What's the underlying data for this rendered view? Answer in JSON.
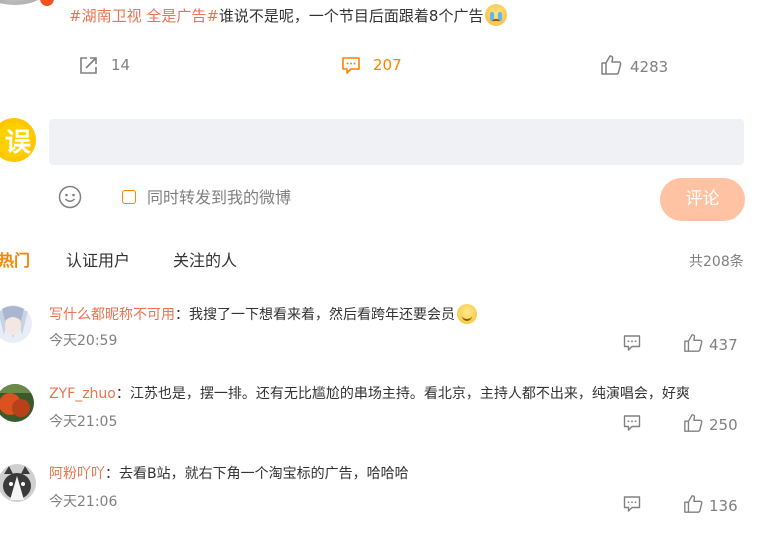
{
  "post": {
    "topic": "#湖南卫视 全是广告#",
    "text": "谁说不是呢，一个节目后面跟着8个广告",
    "emoji_icon": "crying-face-emoji",
    "share_count": "14",
    "comment_count": "207",
    "like_count": "4283"
  },
  "composer": {
    "avatar_text": "误",
    "input_value": "",
    "placeholder": "",
    "repost_label": "同时转发到我的微博",
    "repost_checked": false,
    "submit_label": "评论"
  },
  "tabs": {
    "hot": "热门",
    "verified": "认证用户",
    "following": "关注的人",
    "total": "共208条"
  },
  "comments": [
    {
      "user": "写什么都昵称不可用",
      "separator": "：",
      "text": "我搜了一下想看来着，然后看跨年还要会员",
      "emoji_icon": "smiling-face-emoji",
      "time": "今天20:59",
      "likes": "437"
    },
    {
      "user": "ZYF_zhuo",
      "separator": "：",
      "text": "江苏也是，摆一排。还有无比尴尬的串场主持。看北京，主持人都不出来，纯演唱会，好爽",
      "time": "今天21:05",
      "likes": "250"
    },
    {
      "user": "阿粉吖吖",
      "separator": "：",
      "text": "去看B站，就右下角一个淘宝标的广告，哈哈哈",
      "time": "今天21:06",
      "likes": "136"
    }
  ],
  "colors": {
    "accent": "#ff8200",
    "username": "#eb7350",
    "muted": "#808080",
    "submit_disabled": "#ffc3a3",
    "input_bg": "#f0f1f4"
  }
}
